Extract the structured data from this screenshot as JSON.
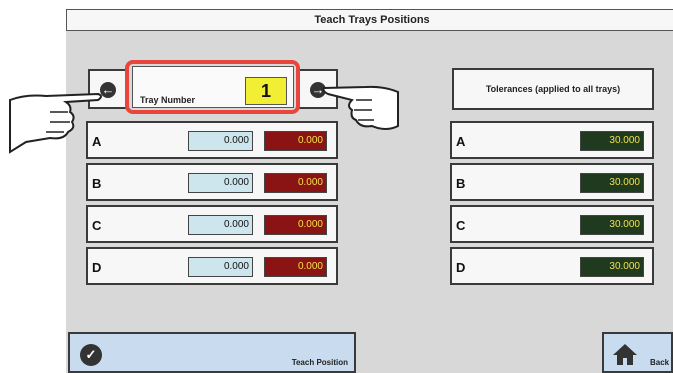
{
  "window": {
    "title": "Teach Trays Positions"
  },
  "tray": {
    "label": "Tray Number",
    "number": "1"
  },
  "positions": [
    {
      "label": "A",
      "position": "0.000",
      "error": "0.000"
    },
    {
      "label": "B",
      "position": "0.000",
      "error": "0.000"
    },
    {
      "label": "C",
      "position": "0.000",
      "error": "0.000"
    },
    {
      "label": "D",
      "position": "0.000",
      "error": "0.000"
    }
  ],
  "tolerances": {
    "header": "Tolerances (applied to all trays)",
    "rows": [
      {
        "label": "A",
        "value": "30.000"
      },
      {
        "label": "B",
        "value": "30.000"
      },
      {
        "label": "C",
        "value": "30.000"
      },
      {
        "label": "D",
        "value": "30.000"
      }
    ]
  },
  "buttons": {
    "teach": "Teach Position",
    "back": "Back"
  },
  "icons": [
    "arrow-left-icon",
    "arrow-right-icon",
    "check-icon",
    "home-icon",
    "pointing-hand-icon"
  ],
  "colors": {
    "highlight": "#e8453c",
    "tray_number_bg": "#f2ee33",
    "error_bg": "#8a1414",
    "tolerance_bg": "#1f3a1f",
    "value_text": "#f2e14a"
  }
}
